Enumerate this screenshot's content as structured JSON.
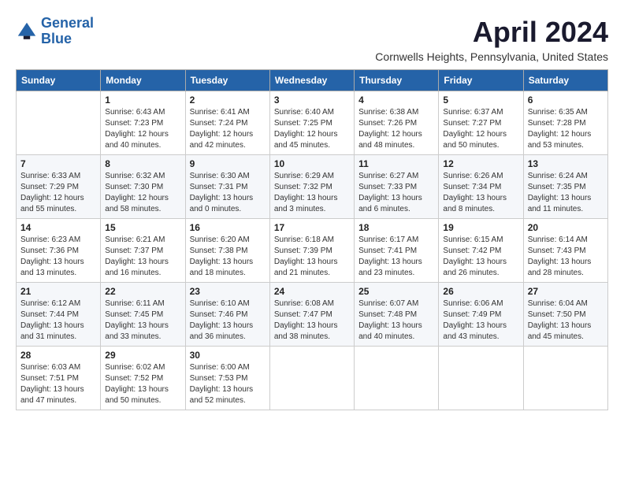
{
  "logo": {
    "line1": "General",
    "line2": "Blue"
  },
  "title": "April 2024",
  "subtitle": "Cornwells Heights, Pennsylvania, United States",
  "days_of_week": [
    "Sunday",
    "Monday",
    "Tuesday",
    "Wednesday",
    "Thursday",
    "Friday",
    "Saturday"
  ],
  "weeks": [
    [
      {
        "num": "",
        "sunrise": "",
        "sunset": "",
        "daylight": ""
      },
      {
        "num": "1",
        "sunrise": "Sunrise: 6:43 AM",
        "sunset": "Sunset: 7:23 PM",
        "daylight": "Daylight: 12 hours and 40 minutes."
      },
      {
        "num": "2",
        "sunrise": "Sunrise: 6:41 AM",
        "sunset": "Sunset: 7:24 PM",
        "daylight": "Daylight: 12 hours and 42 minutes."
      },
      {
        "num": "3",
        "sunrise": "Sunrise: 6:40 AM",
        "sunset": "Sunset: 7:25 PM",
        "daylight": "Daylight: 12 hours and 45 minutes."
      },
      {
        "num": "4",
        "sunrise": "Sunrise: 6:38 AM",
        "sunset": "Sunset: 7:26 PM",
        "daylight": "Daylight: 12 hours and 48 minutes."
      },
      {
        "num": "5",
        "sunrise": "Sunrise: 6:37 AM",
        "sunset": "Sunset: 7:27 PM",
        "daylight": "Daylight: 12 hours and 50 minutes."
      },
      {
        "num": "6",
        "sunrise": "Sunrise: 6:35 AM",
        "sunset": "Sunset: 7:28 PM",
        "daylight": "Daylight: 12 hours and 53 minutes."
      }
    ],
    [
      {
        "num": "7",
        "sunrise": "Sunrise: 6:33 AM",
        "sunset": "Sunset: 7:29 PM",
        "daylight": "Daylight: 12 hours and 55 minutes."
      },
      {
        "num": "8",
        "sunrise": "Sunrise: 6:32 AM",
        "sunset": "Sunset: 7:30 PM",
        "daylight": "Daylight: 12 hours and 58 minutes."
      },
      {
        "num": "9",
        "sunrise": "Sunrise: 6:30 AM",
        "sunset": "Sunset: 7:31 PM",
        "daylight": "Daylight: 13 hours and 0 minutes."
      },
      {
        "num": "10",
        "sunrise": "Sunrise: 6:29 AM",
        "sunset": "Sunset: 7:32 PM",
        "daylight": "Daylight: 13 hours and 3 minutes."
      },
      {
        "num": "11",
        "sunrise": "Sunrise: 6:27 AM",
        "sunset": "Sunset: 7:33 PM",
        "daylight": "Daylight: 13 hours and 6 minutes."
      },
      {
        "num": "12",
        "sunrise": "Sunrise: 6:26 AM",
        "sunset": "Sunset: 7:34 PM",
        "daylight": "Daylight: 13 hours and 8 minutes."
      },
      {
        "num": "13",
        "sunrise": "Sunrise: 6:24 AM",
        "sunset": "Sunset: 7:35 PM",
        "daylight": "Daylight: 13 hours and 11 minutes."
      }
    ],
    [
      {
        "num": "14",
        "sunrise": "Sunrise: 6:23 AM",
        "sunset": "Sunset: 7:36 PM",
        "daylight": "Daylight: 13 hours and 13 minutes."
      },
      {
        "num": "15",
        "sunrise": "Sunrise: 6:21 AM",
        "sunset": "Sunset: 7:37 PM",
        "daylight": "Daylight: 13 hours and 16 minutes."
      },
      {
        "num": "16",
        "sunrise": "Sunrise: 6:20 AM",
        "sunset": "Sunset: 7:38 PM",
        "daylight": "Daylight: 13 hours and 18 minutes."
      },
      {
        "num": "17",
        "sunrise": "Sunrise: 6:18 AM",
        "sunset": "Sunset: 7:39 PM",
        "daylight": "Daylight: 13 hours and 21 minutes."
      },
      {
        "num": "18",
        "sunrise": "Sunrise: 6:17 AM",
        "sunset": "Sunset: 7:41 PM",
        "daylight": "Daylight: 13 hours and 23 minutes."
      },
      {
        "num": "19",
        "sunrise": "Sunrise: 6:15 AM",
        "sunset": "Sunset: 7:42 PM",
        "daylight": "Daylight: 13 hours and 26 minutes."
      },
      {
        "num": "20",
        "sunrise": "Sunrise: 6:14 AM",
        "sunset": "Sunset: 7:43 PM",
        "daylight": "Daylight: 13 hours and 28 minutes."
      }
    ],
    [
      {
        "num": "21",
        "sunrise": "Sunrise: 6:12 AM",
        "sunset": "Sunset: 7:44 PM",
        "daylight": "Daylight: 13 hours and 31 minutes."
      },
      {
        "num": "22",
        "sunrise": "Sunrise: 6:11 AM",
        "sunset": "Sunset: 7:45 PM",
        "daylight": "Daylight: 13 hours and 33 minutes."
      },
      {
        "num": "23",
        "sunrise": "Sunrise: 6:10 AM",
        "sunset": "Sunset: 7:46 PM",
        "daylight": "Daylight: 13 hours and 36 minutes."
      },
      {
        "num": "24",
        "sunrise": "Sunrise: 6:08 AM",
        "sunset": "Sunset: 7:47 PM",
        "daylight": "Daylight: 13 hours and 38 minutes."
      },
      {
        "num": "25",
        "sunrise": "Sunrise: 6:07 AM",
        "sunset": "Sunset: 7:48 PM",
        "daylight": "Daylight: 13 hours and 40 minutes."
      },
      {
        "num": "26",
        "sunrise": "Sunrise: 6:06 AM",
        "sunset": "Sunset: 7:49 PM",
        "daylight": "Daylight: 13 hours and 43 minutes."
      },
      {
        "num": "27",
        "sunrise": "Sunrise: 6:04 AM",
        "sunset": "Sunset: 7:50 PM",
        "daylight": "Daylight: 13 hours and 45 minutes."
      }
    ],
    [
      {
        "num": "28",
        "sunrise": "Sunrise: 6:03 AM",
        "sunset": "Sunset: 7:51 PM",
        "daylight": "Daylight: 13 hours and 47 minutes."
      },
      {
        "num": "29",
        "sunrise": "Sunrise: 6:02 AM",
        "sunset": "Sunset: 7:52 PM",
        "daylight": "Daylight: 13 hours and 50 minutes."
      },
      {
        "num": "30",
        "sunrise": "Sunrise: 6:00 AM",
        "sunset": "Sunset: 7:53 PM",
        "daylight": "Daylight: 13 hours and 52 minutes."
      },
      {
        "num": "",
        "sunrise": "",
        "sunset": "",
        "daylight": ""
      },
      {
        "num": "",
        "sunrise": "",
        "sunset": "",
        "daylight": ""
      },
      {
        "num": "",
        "sunrise": "",
        "sunset": "",
        "daylight": ""
      },
      {
        "num": "",
        "sunrise": "",
        "sunset": "",
        "daylight": ""
      }
    ]
  ]
}
